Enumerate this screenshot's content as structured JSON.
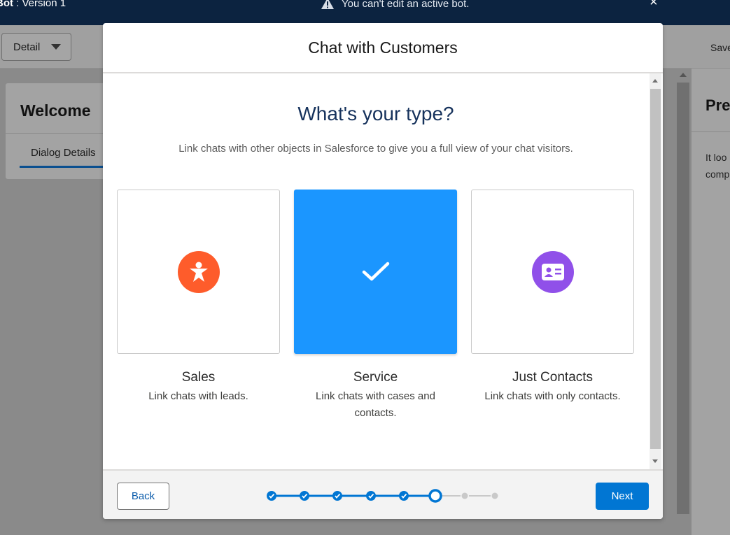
{
  "header": {
    "bot_label": "Bot",
    "version": " : Version 1",
    "warning": "You can't edit an active bot.",
    "close_symbol": "×"
  },
  "toolbar": {
    "detail_label": "Detail",
    "save_label": "Save"
  },
  "left_panel": {
    "title": "Welcome",
    "tab": "Dialog Details"
  },
  "right_panel": {
    "title": "Pre",
    "text_line1": "It loo",
    "text_line2": "comp"
  },
  "modal": {
    "title": "Chat with Customers",
    "heading": "What's your type?",
    "subtext": "Link chats with other objects in Salesforce to give you a full view of your chat visitors.",
    "options": [
      {
        "label": "Sales",
        "description": "Link chats with leads.",
        "icon": "person-icon",
        "color": "#fe5c2b",
        "selected": false
      },
      {
        "label": "Service",
        "description": "Link chats with cases and contacts.",
        "icon": "check-icon",
        "color": "#1b96ff",
        "selected": true
      },
      {
        "label": "Just Contacts",
        "description": "Link chats with only contacts.",
        "icon": "contact-card-icon",
        "color": "#9050e9",
        "selected": false
      }
    ],
    "back_label": "Back",
    "next_label": "Next",
    "progress": {
      "total_steps": 9,
      "completed_steps": 5,
      "current_step": 6
    }
  },
  "colors": {
    "header_bg": "#0c2340",
    "brand_blue": "#0176d3",
    "heading_text": "#16325c"
  }
}
